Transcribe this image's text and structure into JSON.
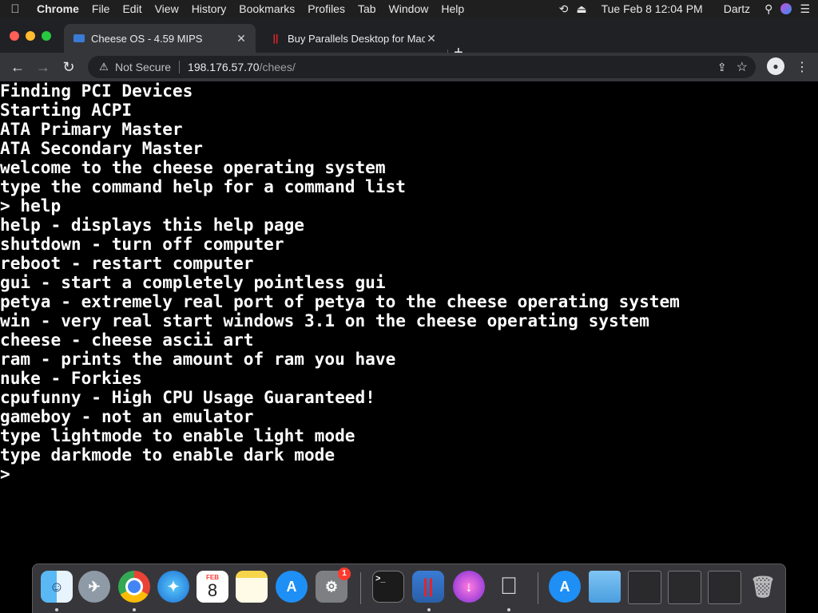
{
  "menubar": {
    "apple": "",
    "app_name": "Chrome",
    "menus": [
      "File",
      "Edit",
      "View",
      "History",
      "Bookmarks",
      "Profiles",
      "Tab",
      "Window",
      "Help"
    ],
    "date_time": "Tue Feb 8  12:04 PM",
    "user": "Dartz",
    "status_icons": [
      "time-machine-icon",
      "eject-icon",
      "search-icon",
      "siri-icon",
      "control-center-icon"
    ]
  },
  "tabs": [
    {
      "title": "Cheese OS - 4.59 MIPS",
      "favicon": "monitor-icon",
      "active": true
    },
    {
      "title": "Buy Parallels Desktop for Mac",
      "favicon": "parallels-icon",
      "active": false
    }
  ],
  "omnibox": {
    "security_label": "Not Secure",
    "host": "198.176.57.70",
    "path": "/chees/"
  },
  "terminal": {
    "lines": [
      "Finding PCI Devices",
      "Starting ACPI",
      "ATA Primary Master",
      "ATA Secondary Master",
      "welcome to the cheese operating system",
      "type the command help for a command list",
      "> help",
      "help - displays this help page",
      "shutdown - turn off computer",
      "reboot - restart computer",
      "gui - start a completely pointless gui",
      "petya - extremely real port of petya to the cheese operating system",
      "win - very real start windows 3.1 on the cheese operating system",
      "cheese - cheese ascii art",
      "ram - prints the amount of ram you have",
      "nuke - Forkies",
      "cpufunny - High CPU Usage Guaranteed!",
      "gameboy - not an emulator",
      "type lightmode to enable light mode",
      "type darkmode to enable dark mode",
      ">"
    ]
  },
  "dock": {
    "calendar_month": "FEB",
    "calendar_day": "8",
    "settings_badge": "1",
    "apps": [
      "finder",
      "launchpad",
      "chrome",
      "safari",
      "calendar",
      "notes",
      "app-store",
      "system-preferences",
      "terminal",
      "parallels-windows",
      "installer",
      "podcasts-like",
      "parallels-macos",
      "app-store-2",
      "folder",
      "window-1",
      "window-2",
      "window-3",
      "trash"
    ]
  }
}
